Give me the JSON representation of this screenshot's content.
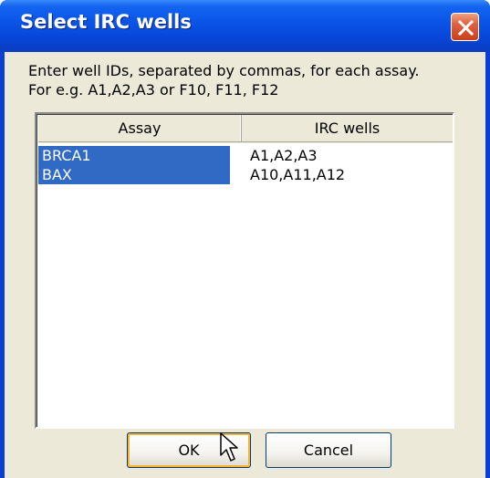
{
  "window": {
    "title": "Select IRC wells"
  },
  "instructions": {
    "line1": "Enter well IDs, separated by commas, for each assay.",
    "line2": "For e.g. A1,A2,A3 or F10, F11, F12"
  },
  "table": {
    "columns": [
      "Assay",
      "IRC wells"
    ],
    "rows": [
      {
        "assay": "BRCA1",
        "wells": "A1,A2,A3"
      },
      {
        "assay": "BAX",
        "wells": "A10,A11,A12"
      }
    ]
  },
  "buttons": {
    "ok_label": "OK",
    "cancel_label": "Cancel"
  },
  "icons": {
    "close": "close-icon",
    "cursor": "mouse-pointer-icon"
  },
  "colors": {
    "titlebar": "#0a56e8",
    "selection": "#316ac5",
    "dialog_bg": "#ece9d8",
    "close_button": "#e06040",
    "focus_ring": "#f8b330"
  }
}
